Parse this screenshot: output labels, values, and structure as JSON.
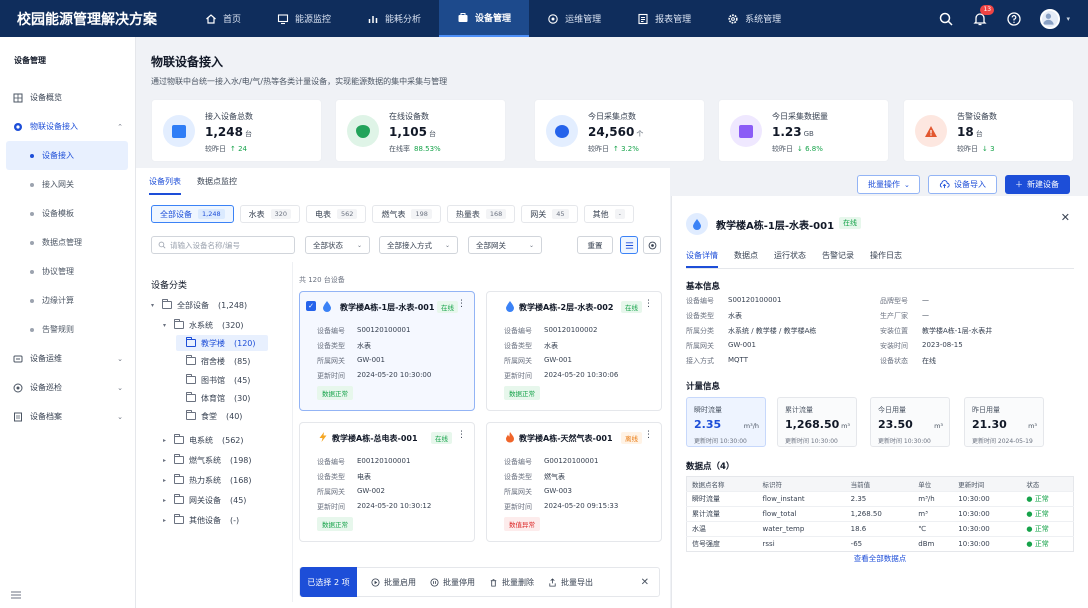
{
  "app": {
    "title": "校园能源管理解决方案",
    "notification_count": "13"
  },
  "nav": [
    {
      "label": "首页"
    },
    {
      "label": "能源监控"
    },
    {
      "label": "能耗分析"
    },
    {
      "label": "设备管理"
    },
    {
      "label": "运维管理"
    },
    {
      "label": "报表管理"
    },
    {
      "label": "系统管理"
    }
  ],
  "sidebar": {
    "title": "设备管理",
    "items": {
      "overview": "设备概览",
      "iot": "物联设备接入",
      "ops": "设备运维",
      "inspect": "设备巡检",
      "archive": "设备档案"
    },
    "sub": [
      "设备接入",
      "接入网关",
      "设备模板",
      "数据点管理",
      "协议管理",
      "边缘计算",
      "告警规则"
    ]
  },
  "page": {
    "title": "物联设备接入",
    "subtitle": "通过物联中台统一接入水/电/气/热等各类计量设备，实现能源数据的集中采集与管理"
  },
  "stats": [
    {
      "label": "接入设备总数",
      "value": "1,248",
      "unit": "台",
      "sub_label": "较昨日",
      "sub_value": "↑ 24",
      "color": "#2f7df6",
      "bg": "#e3eeff"
    },
    {
      "label": "在线设备数",
      "value": "1,105",
      "unit": "台",
      "sub_label": "在线率",
      "sub_value": "88.53%",
      "color": "#22a35a",
      "bg": "#dff4e7"
    },
    {
      "label": "今日采集点数",
      "value": "24,560",
      "unit": "个",
      "sub_label": "较昨日",
      "sub_value": "↑ 3.2%",
      "color": "#2563eb",
      "bg": "#e3eeff"
    },
    {
      "label": "今日采集数据量",
      "value": "1.23",
      "unit": "GB",
      "sub_label": "较昨日",
      "sub_value": "↓ 6.8%",
      "color": "#8b5cf6",
      "bg": "#efe8ff"
    },
    {
      "label": "告警设备数",
      "value": "18",
      "unit": "台",
      "sub_label": "较昨日",
      "sub_value": "↓ 3",
      "color": "#e2572f",
      "bg": "#fde7e0"
    }
  ],
  "toolbar": {
    "batch": "批量操作",
    "import": "设备导入",
    "new": "新建设备"
  },
  "tabs": [
    "设备列表",
    "数据点监控"
  ],
  "chips": [
    {
      "label": "全部设备",
      "count": "1,248"
    },
    {
      "label": "水表",
      "count": "320"
    },
    {
      "label": "电表",
      "count": "562"
    },
    {
      "label": "燃气表",
      "count": "198"
    },
    {
      "label": "热量表",
      "count": "168"
    },
    {
      "label": "网关",
      "count": "45"
    },
    {
      "label": "其他",
      "count": "-"
    }
  ],
  "filters": {
    "search_placeholder": "请输入设备名称/编号",
    "status": "全部状态",
    "access": "全部接入方式",
    "gateway": "全部网关",
    "reset": "重置"
  },
  "tree": {
    "title": "设备分类",
    "root": "全部设备",
    "root_count": "(1,248)",
    "water": "水系统",
    "water_count": "(320)",
    "water_children": [
      {
        "label": "教学楼",
        "count": "(120)"
      },
      {
        "label": "宿舍楼",
        "count": "(85)"
      },
      {
        "label": "图书馆",
        "count": "(45)"
      },
      {
        "label": "体育馆",
        "count": "(30)"
      },
      {
        "label": "食堂",
        "count": "(40)"
      }
    ],
    "others": [
      {
        "label": "电系统",
        "count": "(562)"
      },
      {
        "label": "燃气系统",
        "count": "(198)"
      },
      {
        "label": "热力系统",
        "count": "(168)"
      },
      {
        "label": "网关设备",
        "count": "(45)"
      },
      {
        "label": "其他设备",
        "count": "(-)"
      }
    ]
  },
  "list": {
    "count_text": "共 120 台设备"
  },
  "field_labels": {
    "code": "设备编号",
    "type": "设备类型",
    "gateway": "所属网关",
    "updated": "更新时间"
  },
  "cards": [
    {
      "title": "教学楼A栋-1层-水表-001",
      "tag": "在线",
      "code": "S00120100001",
      "type": "水表",
      "gateway": "GW-001",
      "updated": "2024-05-20 10:30:00",
      "status": "数据正常"
    },
    {
      "title": "教学楼A栋-2层-水表-002",
      "tag": "在线",
      "code": "S00120100002",
      "type": "水表",
      "gateway": "GW-001",
      "updated": "2024-05-20 10:30:06",
      "status": "数据正常"
    },
    {
      "title": "教学楼A栋-总电表-001",
      "tag": "在线",
      "code": "E00120100001",
      "type": "电表",
      "gateway": "GW-002",
      "updated": "2024-05-20 10:30:12",
      "status": "数据正常"
    },
    {
      "title": "教学楼A栋-天然气表-001",
      "tag": "离线",
      "code": "G00120100001",
      "type": "燃气表",
      "gateway": "GW-003",
      "updated": "2024-05-20 09:15:33",
      "status": "数值异常"
    }
  ],
  "bulk": {
    "selected": "已选择 2 项",
    "enable": "批量启用",
    "disable": "批量停用",
    "delete": "批量删除",
    "export": "批量导出"
  },
  "detail": {
    "title": "教学楼A栋-1层-水表-001",
    "tag": "在线",
    "tabs": [
      "设备详情",
      "数据点",
      "运行状态",
      "告警记录",
      "操作日志"
    ],
    "basic_title": "基本信息",
    "basic_left": [
      {
        "k": "设备编号",
        "v": "S00120100001"
      },
      {
        "k": "设备类型",
        "v": "水表"
      },
      {
        "k": "所属分类",
        "v": "水系统 / 教学楼 / 教学楼A栋"
      },
      {
        "k": "所属网关",
        "v": "GW-001"
      },
      {
        "k": "接入方式",
        "v": "MQTT"
      }
    ],
    "basic_right": [
      {
        "k": "品牌型号",
        "v": "—"
      },
      {
        "k": "生产厂家",
        "v": "—"
      },
      {
        "k": "安装位置",
        "v": "教学楼A栋-1层-水表井"
      },
      {
        "k": "安装时间",
        "v": "2023-08-15"
      },
      {
        "k": "设备状态",
        "v": "在线"
      }
    ],
    "metrics_title": "计量信息",
    "metrics": [
      {
        "label": "瞬时流量",
        "value": "2.35",
        "unit": "m³/h",
        "time": "更新时间 10:30:00"
      },
      {
        "label": "累计流量",
        "value": "1,268.50",
        "unit": "m³",
        "time": "更新时间 10:30:00"
      },
      {
        "label": "今日用量",
        "value": "23.50",
        "unit": "m³",
        "time": "更新时间 10:30:00"
      },
      {
        "label": "昨日用量",
        "value": "21.30",
        "unit": "m³",
        "time": "更新时间 2024-05-19"
      }
    ],
    "points_title": "数据点（4）",
    "points_headers": [
      "数据点名称",
      "标识符",
      "当前值",
      "单位",
      "更新时间",
      "状态"
    ],
    "points": [
      [
        "瞬时流量",
        "flow_instant",
        "2.35",
        "m³/h",
        "10:30:00",
        "● 正常"
      ],
      [
        "累计流量",
        "flow_total",
        "1,268.50",
        "m³",
        "10:30:00",
        "● 正常"
      ],
      [
        "水温",
        "water_temp",
        "18.6",
        "℃",
        "10:30:00",
        "● 正常"
      ],
      [
        "信号强度",
        "rssi",
        "-65",
        "dBm",
        "10:30:00",
        "● 正常"
      ]
    ],
    "view_all": "查看全部数据点"
  }
}
